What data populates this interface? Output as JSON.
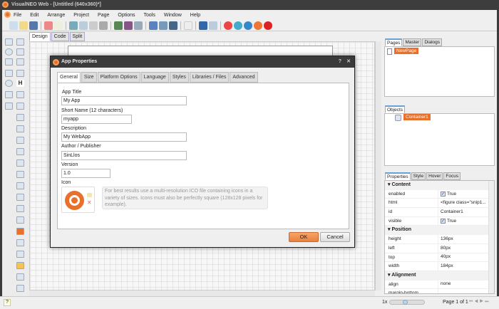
{
  "window": {
    "title": "VisualNEO Web - [Untitled (640x360)*]"
  },
  "menu": [
    "File",
    "Edit",
    "Arrange",
    "Project",
    "Page",
    "Options",
    "Tools",
    "Window",
    "Help"
  ],
  "doc_tabs": [
    "Design",
    "Code",
    "Split"
  ],
  "pages_panel": {
    "tabs": [
      "Pages",
      "Master",
      "Dialogs"
    ],
    "items": [
      "NewPage"
    ]
  },
  "objects_panel": {
    "tabs": [
      "Objects"
    ],
    "items": [
      "Container1"
    ]
  },
  "properties_panel": {
    "tabs": [
      "Properties",
      "Style",
      "Hover",
      "Focus"
    ],
    "sections": [
      {
        "title": "Content",
        "rows": [
          {
            "key": "enabled",
            "value": "True",
            "checkbox": true
          },
          {
            "key": "html",
            "value": "<figure class=\"snip1..."
          },
          {
            "key": "id",
            "value": "Container1"
          },
          {
            "key": "visible",
            "value": "True",
            "checkbox": true
          }
        ]
      },
      {
        "title": "Position",
        "rows": [
          {
            "key": "height",
            "value": "136px"
          },
          {
            "key": "left",
            "value": "80px"
          },
          {
            "key": "top",
            "value": "40px"
          },
          {
            "key": "width",
            "value": "184px"
          }
        ]
      },
      {
        "title": "Alignment",
        "rows": [
          {
            "key": "align",
            "value": "none"
          },
          {
            "key": "margin-bottom",
            "value": ""
          }
        ]
      }
    ]
  },
  "statusbar": {
    "zoom": "1x",
    "page": "Page 1 of 1",
    "help": "?"
  },
  "dialog": {
    "title": "App Properties",
    "help": "?",
    "close": "✕",
    "tabs": [
      "General",
      "Size",
      "Platform Options",
      "Language",
      "Styles",
      "Libraries / Files",
      "Advanced"
    ],
    "fields": {
      "app_title_label": "App Title",
      "app_title": "My App",
      "short_name_label": "Short Name (12 characters)",
      "short_name": "myapp",
      "description_label": "Description",
      "description": "My WebApp",
      "author_label": "Author / Publisher",
      "author": "SinLlos",
      "version_label": "Version",
      "version": "1.0",
      "icon_label": "Icon"
    },
    "icon_hint": "For best results use a multi-resolution ICO file containing icons in a variety of sizes. Icons must also be perfectly square (128x128 pixels for example).",
    "ok": "OK",
    "cancel": "Cancel"
  },
  "colors": {
    "accent": "#e8702a",
    "titlebar": "#3a3a3a"
  }
}
